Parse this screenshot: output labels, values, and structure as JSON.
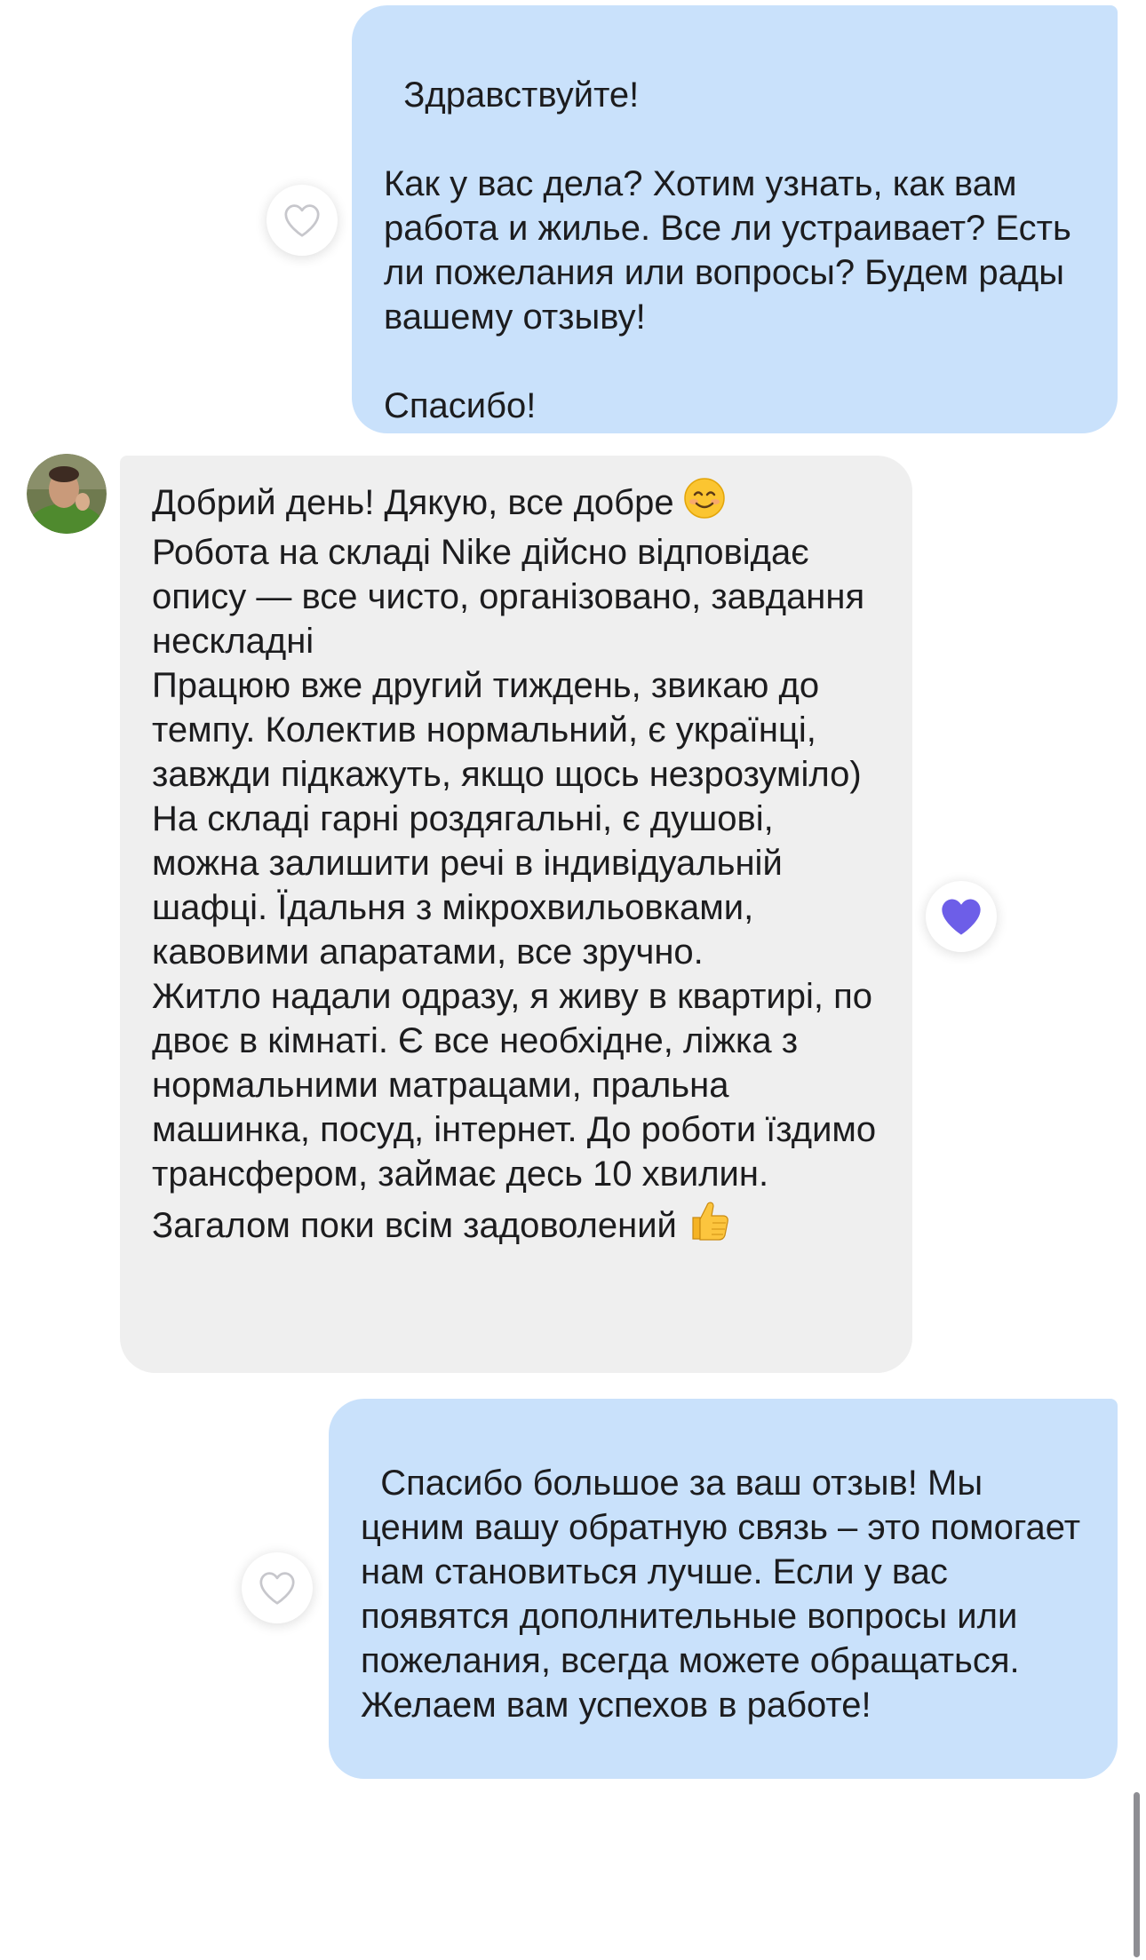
{
  "colors": {
    "outgoing_bubble": "#c9e1fb",
    "incoming_bubble": "#efefef",
    "reaction_heart": "#6d5ee8",
    "outline_heart": "#c7c7cc"
  },
  "messages": [
    {
      "direction": "outgoing",
      "text": "Здравствуйте!\n\nКак у вас дела? Хотим узнать, как вам работа и жилье. Все ли устраивает? Есть ли пожелания или вопросы? Будем рады вашему отзыву!\n\nСпасибо!",
      "reaction": "heart-outline-icon"
    },
    {
      "direction": "incoming",
      "avatar": "sender-avatar",
      "text_intro": "Добрий день! Дякую, все добре",
      "emoji_intro": "smiling-face-emoji",
      "text_body": "Робота на складі Nike дійсно відповідає опису — все чисто, організовано, завдання нескладні\nПрацюю вже другий тиждень, звикаю до темпу. Колектив нормальний, є українці, завжди підкажуть, якщо щось незрозуміло)\nНа складі гарні роздягальні, є душові, можна залишити речі в індивідуальній шафці. Їдальня з мікрохвильовками, кавовими апаратами, все зручно.\nЖитло надали одразу, я живу в квартирі, по двоє в кімнаті. Є все необхідне, ліжка з нормальними матрацами, пральна машинка, посуд, інтернет. До роботи їздимо трансфером, займає десь 10 хвилин.\nЗагалом поки всім задоволений",
      "emoji_end": "thumbs-up-emoji",
      "reaction": "heart-filled-icon"
    },
    {
      "direction": "outgoing",
      "text": "Спасибо большое за ваш отзыв! Мы ценим вашу обратную связь – это помогает нам становиться лучше. Если у вас появятся дополнительные вопросы или пожелания, всегда можете обращаться. Желаем вам успехов в работе!",
      "reaction": "heart-outline-icon"
    }
  ]
}
